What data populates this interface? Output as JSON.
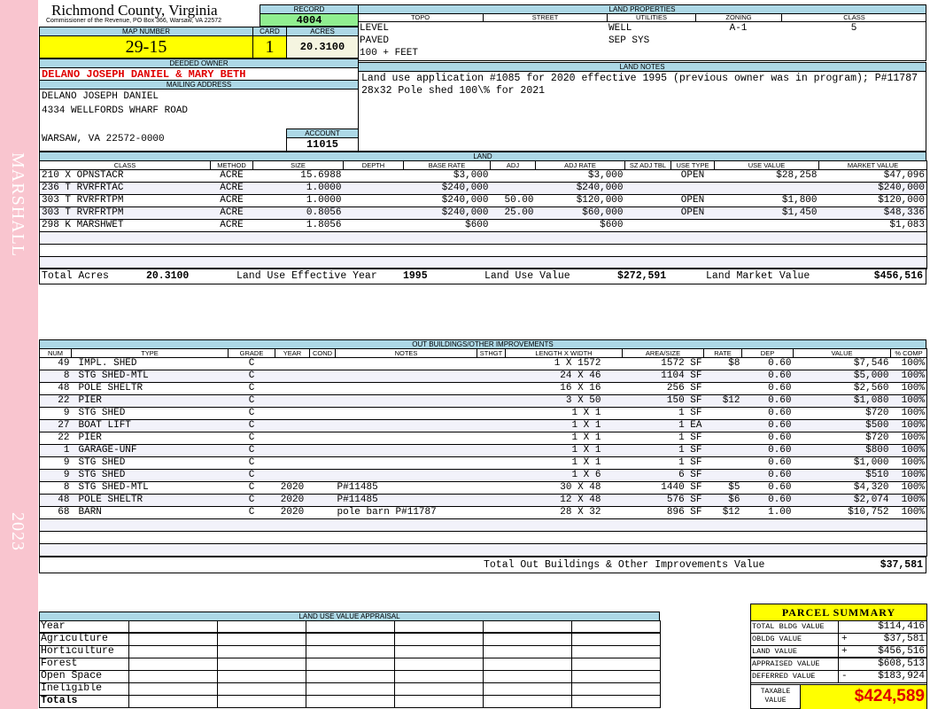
{
  "side": {
    "district": "MARSHALL",
    "year": "2023"
  },
  "header": {
    "title": "Richmond County, Virginia",
    "subtitle": "Commissioner of the Revenue, PO Box 366, Warsaw, VA 22572"
  },
  "record": {
    "label": "RECORD",
    "value": "4004"
  },
  "map": {
    "label": "MAP NUMBER",
    "value": "29-15"
  },
  "card": {
    "label": "CARD",
    "value": "1"
  },
  "acres": {
    "label": "ACRES",
    "value": "20.3100"
  },
  "owner": {
    "label": "DEEDED OWNER",
    "value": "DELANO JOSEPH DANIEL & MARY BETH"
  },
  "mailing": {
    "label": "MAILING ADDRESS",
    "lines": [
      "DELANO JOSEPH DANIEL",
      "4334 WELLFORDS WHARF ROAD",
      "",
      "WARSAW, VA 22572-0000"
    ]
  },
  "account": {
    "label": "ACCOUNT",
    "value": "11015"
  },
  "land_properties": {
    "label": "LAND PROPERTIES",
    "columns": [
      "TOPO",
      "STREET",
      "UTILITIES",
      "ZONING",
      "CLASS"
    ],
    "topo": [
      "LEVEL",
      "PAVED",
      "100 + FEET"
    ],
    "street": [],
    "utilities": [
      "WELL",
      "SEP SYS"
    ],
    "zoning": [
      "A-1"
    ],
    "class": [
      "5"
    ]
  },
  "land_notes": {
    "label": "LAND NOTES",
    "text": "Land use application #1085 for 2020 effective 1995 (previous owner was in program); P#11787 28x32 Pole shed 100\\% for 2021"
  },
  "land": {
    "label": "LAND",
    "columns": [
      "CLASS",
      "METHOD",
      "SIZE",
      "DEPTH",
      "BASE RATE",
      "ADJ",
      "ADJ RATE",
      "SZ ADJ TBL",
      "USE TYPE",
      "USE VALUE",
      "MARKET VALUE"
    ],
    "rows": [
      [
        "210 X OPNSTACR",
        "ACRE",
        "15.6988",
        "",
        "$3,000",
        "",
        "$3,000",
        "",
        "OPEN",
        "$28,258",
        "$47,096"
      ],
      [
        "236 T RVRFRTAC",
        "ACRE",
        "1.0000",
        "",
        "$240,000",
        "",
        "$240,000",
        "",
        "",
        "",
        "$240,000"
      ],
      [
        "303 T RVRFRTPM",
        "ACRE",
        "1.0000",
        "",
        "$240,000",
        "50.00",
        "$120,000",
        "",
        "OPEN",
        "$1,800",
        "$120,000"
      ],
      [
        "303 T RVRFRTPM",
        "ACRE",
        "0.8056",
        "",
        "$240,000",
        "25.00",
        "$60,000",
        "",
        "OPEN",
        "$1,450",
        "$48,336"
      ],
      [
        "298 K MARSHWET",
        "ACRE",
        "1.8056",
        "",
        "$600",
        "",
        "$600",
        "",
        "",
        "",
        "$1,083"
      ]
    ],
    "totals": {
      "acres_label": "Total Acres",
      "acres": "20.3100",
      "year_label": "Land Use Effective Year",
      "year": "1995",
      "use_label": "Land Use Value",
      "use": "$272,591",
      "market_label": "Land Market Value",
      "market": "$456,516"
    }
  },
  "outbuildings": {
    "label": "OUT BUILDINGS/OTHER IMPROVEMENTS",
    "columns": [
      "NUM",
      "TYPE",
      "GRADE",
      "YEAR",
      "COND",
      "NOTES",
      "STHGT",
      "LENGTH X WIDTH",
      "AREA/SIZE",
      "RATE",
      "DEP",
      "VALUE",
      "% COMP"
    ],
    "rows": [
      [
        "49",
        "IMPL. SHED",
        "C",
        "",
        "",
        "",
        "",
        "1 X 1572",
        "1572 SF",
        "$8",
        "0.60",
        "$7,546",
        "100%"
      ],
      [
        "8",
        "STG SHED-MTL",
        "C",
        "",
        "",
        "",
        "",
        "24 X 46",
        "1104 SF",
        "",
        "0.60",
        "$5,000",
        "100%"
      ],
      [
        "48",
        "POLE SHELTR",
        "C",
        "",
        "",
        "",
        "",
        "16 X 16",
        "256 SF",
        "",
        "0.60",
        "$2,560",
        "100%"
      ],
      [
        "22",
        "PIER",
        "C",
        "",
        "",
        "",
        "",
        "3 X 50",
        "150 SF",
        "$12",
        "0.60",
        "$1,080",
        "100%"
      ],
      [
        "9",
        "STG SHED",
        "C",
        "",
        "",
        "",
        "",
        "1 X 1",
        "1 SF",
        "",
        "0.60",
        "$720",
        "100%"
      ],
      [
        "27",
        "BOAT LIFT",
        "C",
        "",
        "",
        "",
        "",
        "1 X 1",
        "1 EA",
        "",
        "0.60",
        "$500",
        "100%"
      ],
      [
        "22",
        "PIER",
        "C",
        "",
        "",
        "",
        "",
        "1 X 1",
        "1 SF",
        "",
        "0.60",
        "$720",
        "100%"
      ],
      [
        "1",
        "GARAGE-UNF",
        "C",
        "",
        "",
        "",
        "",
        "1 X 1",
        "1 SF",
        "",
        "0.60",
        "$800",
        "100%"
      ],
      [
        "9",
        "STG SHED",
        "C",
        "",
        "",
        "",
        "",
        "1 X 1",
        "1 SF",
        "",
        "0.60",
        "$1,000",
        "100%"
      ],
      [
        "9",
        "STG SHED",
        "C",
        "",
        "",
        "",
        "",
        "1 X 6",
        "6 SF",
        "",
        "0.60",
        "$510",
        "100%"
      ],
      [
        "8",
        "STG SHED-MTL",
        "C",
        "2020",
        "",
        "P#11485",
        "",
        "30 X 48",
        "1440 SF",
        "$5",
        "0.60",
        "$4,320",
        "100%"
      ],
      [
        "48",
        "POLE SHELTR",
        "C",
        "2020",
        "",
        "P#11485",
        "",
        "12 X 48",
        "576 SF",
        "$6",
        "0.60",
        "$2,074",
        "100%"
      ],
      [
        "68",
        "BARN",
        "C",
        "2020",
        "",
        "pole barn P#11787",
        "",
        "28 X 32",
        "896 SF",
        "$12",
        "1.00",
        "$10,752",
        "100%"
      ]
    ],
    "total_label": "Total Out Buildings & Other Improvements Value",
    "total": "$37,581"
  },
  "land_use": {
    "label": "LAND USE VALUE APPRAISAL",
    "rows": [
      "Year",
      "Agriculture",
      "Horticulture",
      "Forest",
      "Open Space",
      "Ineligible",
      "Totals"
    ]
  },
  "summary": {
    "title": "PARCEL SUMMARY",
    "rows": [
      {
        "label": "TOTAL BLDG VALUE",
        "op": "",
        "value": "$114,416"
      },
      {
        "label": "OBLDG VALUE",
        "op": "+",
        "value": "$37,581"
      },
      {
        "label": "LAND VALUE",
        "op": "+",
        "value": "$456,516"
      },
      {
        "label": "APPRAISED VALUE",
        "op": "",
        "value": "$608,513"
      },
      {
        "label": "DEFERRED VALUE",
        "op": "-",
        "value": "$183,924"
      }
    ],
    "taxable_label": "TAXABLE VALUE",
    "taxable": "$424,589"
  },
  "colors": {
    "header_bg": "#add8e6",
    "highlight": "#ffff00",
    "record": "#90ee90",
    "owner": "#e00000",
    "strip": "#f9c5cf"
  }
}
